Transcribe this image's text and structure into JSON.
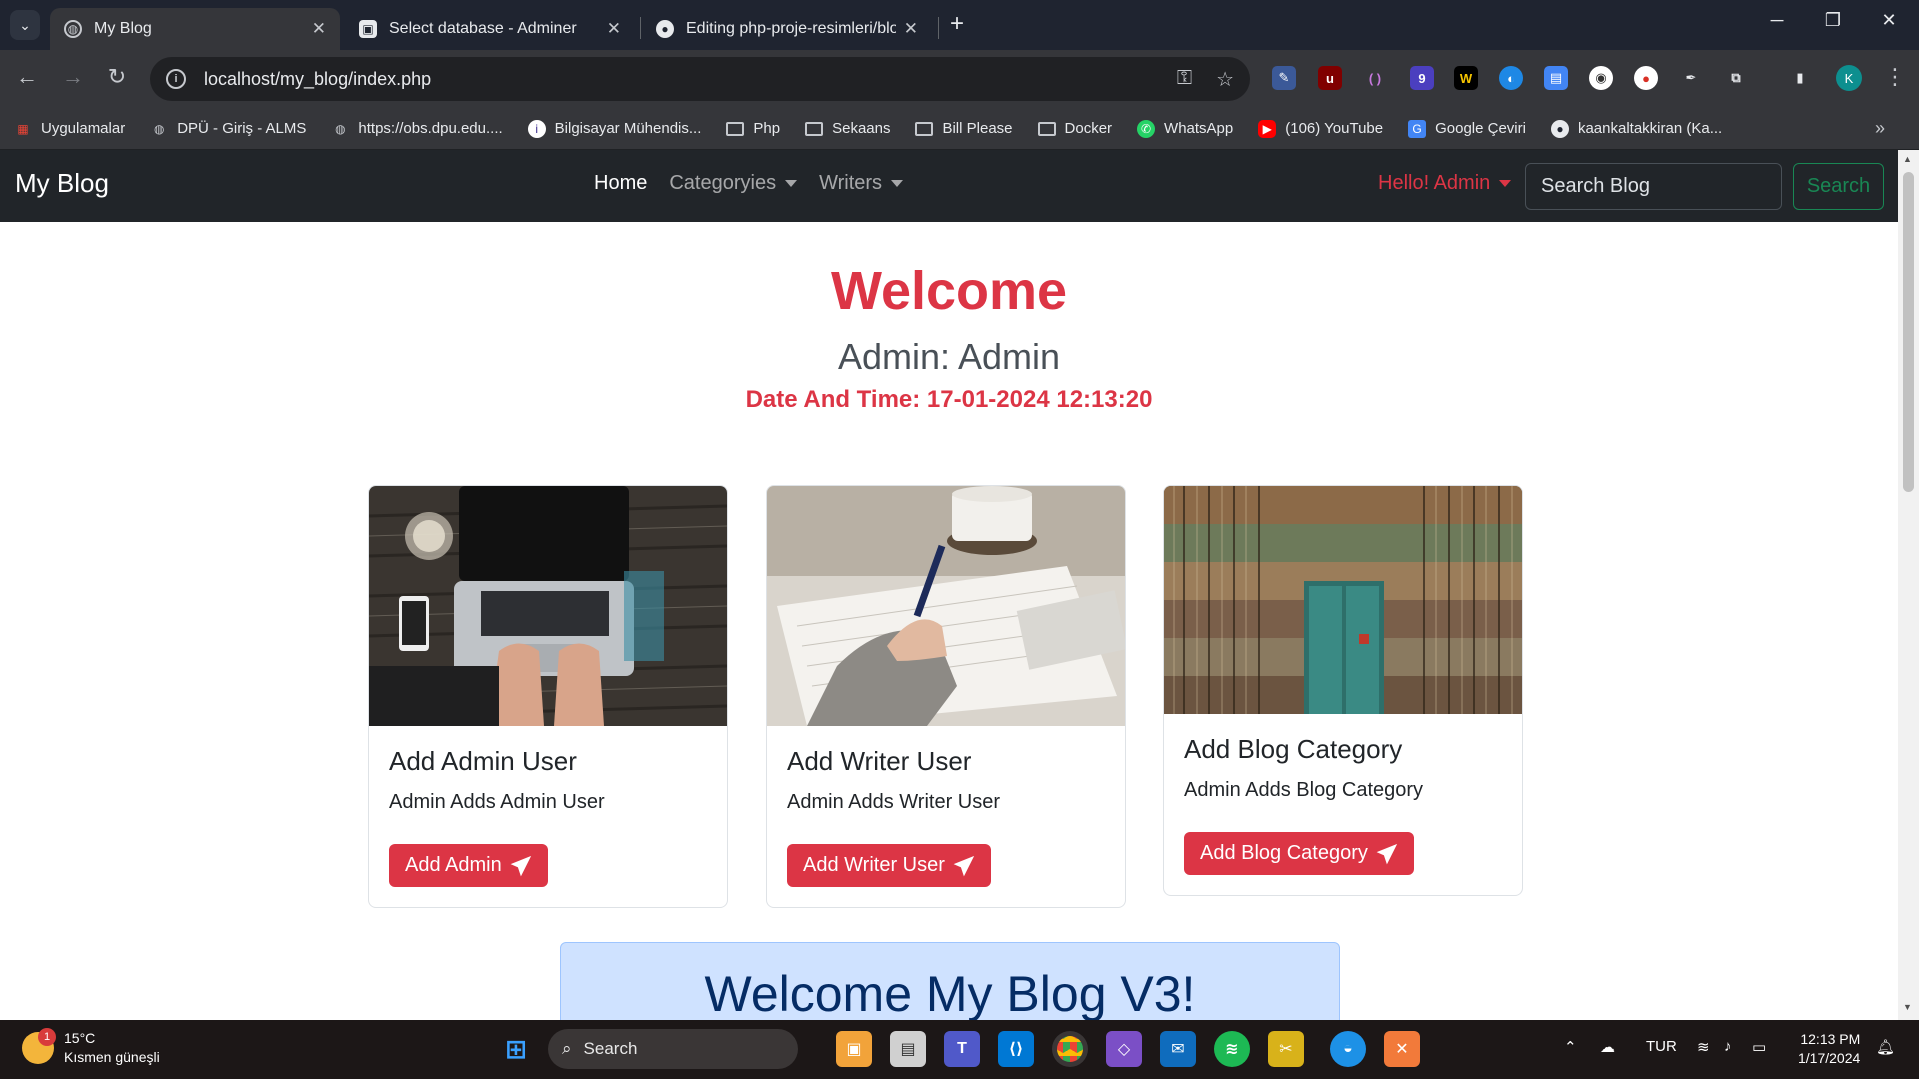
{
  "browser": {
    "tabs": [
      {
        "title": "My Blog",
        "active": true
      },
      {
        "title": "Select database - Adminer",
        "active": false
      },
      {
        "title": "Editing php-proje-resimleri/blo",
        "active": false
      }
    ],
    "url": "localhost/my_blog/index.php",
    "profile_initial": "K",
    "extensions": [
      "pen-icon",
      "ublock-icon",
      "brackets-icon",
      "badge-9-icon",
      "w-icon",
      "edge-icon",
      "file-icon",
      "circle-icon",
      "record-icon",
      "dropper-icon",
      "puzzle-icon"
    ],
    "extension_badge": "9",
    "bookmarks": [
      {
        "label": "Uygulamalar",
        "icon": "apps-grid-icon"
      },
      {
        "label": "DPÜ - Giriş - ALMS",
        "icon": "globe-icon"
      },
      {
        "label": "https://obs.dpu.edu....",
        "icon": "globe-icon"
      },
      {
        "label": "Bilgisayar Mühendis...",
        "icon": "info-icon"
      },
      {
        "label": "Php",
        "icon": "folder-icon"
      },
      {
        "label": "Sekaans",
        "icon": "folder-icon"
      },
      {
        "label": "Bill Please",
        "icon": "folder-icon"
      },
      {
        "label": "Docker",
        "icon": "folder-icon"
      },
      {
        "label": "WhatsApp",
        "icon": "whatsapp-icon"
      },
      {
        "label": "(106) YouTube",
        "icon": "youtube-icon"
      },
      {
        "label": "Google Çeviri",
        "icon": "translate-icon"
      },
      {
        "label": "kaankaltakkiran (Ka...",
        "icon": "github-icon"
      }
    ]
  },
  "site": {
    "brand": "My Blog",
    "nav": {
      "home": "Home",
      "categories": "Categoryies",
      "writers": "Writers"
    },
    "user_menu": "Hello! Admin",
    "search_placeholder": "Search Blog",
    "search_button": "Search",
    "hero": {
      "title": "Welcome",
      "subtitle": "Admin: Admin",
      "datetime": "Date And Time: 17-01-2024 12:13:20"
    },
    "cards": [
      {
        "title": "Add Admin User",
        "text": "Admin Adds Admin User",
        "button": "Add Admin",
        "image": "laptop-desk-photo"
      },
      {
        "title": "Add Writer User",
        "text": "Admin Adds Writer User",
        "button": "Add Writer User",
        "image": "writing-hand-photo"
      },
      {
        "title": "Add Blog Category",
        "text": "Admin Adds Blog Category",
        "button": "Add Blog Category",
        "image": "bookshelf-photo"
      }
    ],
    "banner": "Welcome My Blog V3!"
  },
  "taskbar": {
    "weather_temp": "15°C",
    "weather_desc": "Kısmen güneşli",
    "weather_badge": "1",
    "search": "Search",
    "language": "TUR",
    "time": "12:13 PM",
    "date": "1/17/2024"
  },
  "colors": {
    "accent_red": "#dc3545",
    "navbar_dark": "#212529",
    "success_green": "#198754",
    "banner_blue": "#cfe2ff"
  }
}
